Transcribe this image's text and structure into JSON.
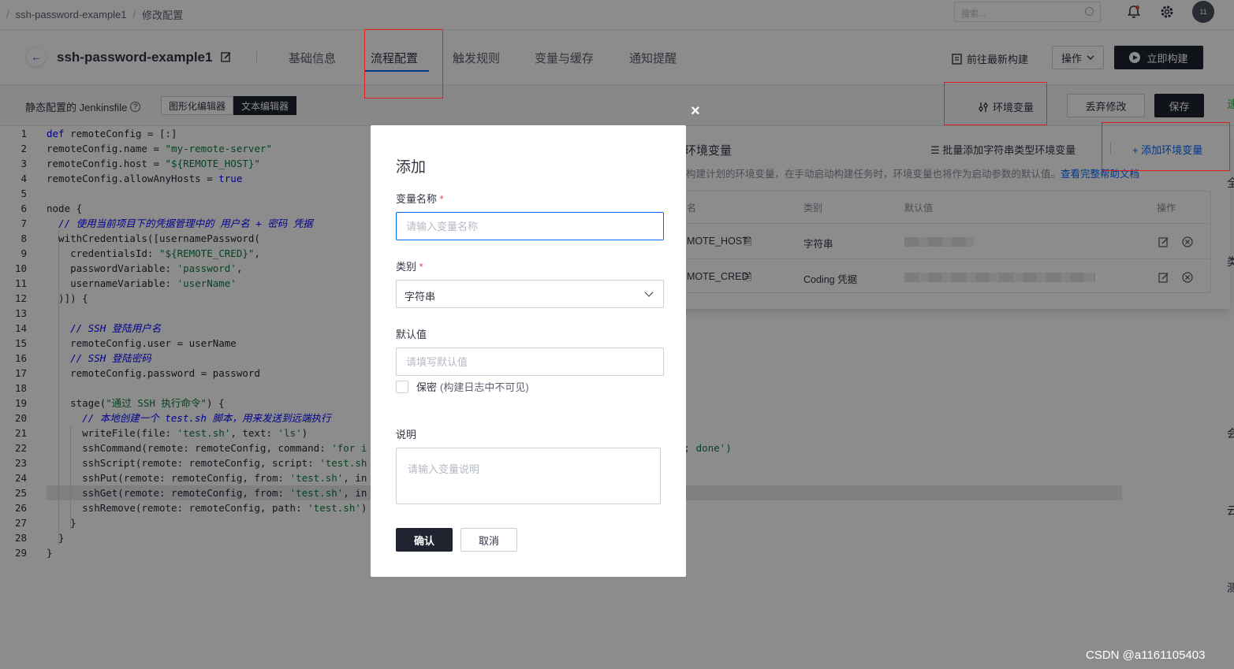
{
  "breadcrumb": {
    "project": "ssh-password-example1",
    "separator": "/",
    "page": "修改配置"
  },
  "topbar": {
    "search_placeholder": "搜索...",
    "avatar_text": "11"
  },
  "header": {
    "project_name": "ssh-password-example1",
    "tabs": [
      {
        "label": "基础信息",
        "active": false
      },
      {
        "label": "流程配置",
        "active": true
      },
      {
        "label": "触发规则",
        "active": false
      },
      {
        "label": "变量与缓存",
        "active": false
      },
      {
        "label": "通知提醒",
        "active": false
      }
    ],
    "latest_build_label": "前往最新构建",
    "operation_label": "操作",
    "build_now_label": "立即构建"
  },
  "toolbar": {
    "static_label": "静态配置的 Jenkinsfile",
    "help_glyph": "?",
    "editor_modes": [
      "图形化编辑器",
      "文本编辑器"
    ],
    "active_mode": "文本编辑器",
    "env_label": "环境变量",
    "discard_label": "丢弃修改",
    "save_label": "保存"
  },
  "code": [
    "def remoteConfig = [:]",
    "remoteConfig.name = \"my-remote-server\"",
    "remoteConfig.host = \"${REMOTE_HOST}\"",
    "remoteConfig.allowAnyHosts = true",
    "",
    "node {",
    "  // 使用当前项目下的凭据管理中的 用户名 + 密码 凭据",
    "  withCredentials([usernamePassword(",
    "    credentialsId: \"${REMOTE_CRED}\",",
    "    passwordVariable: 'password',",
    "    usernameVariable: 'userName'",
    "  )]) {",
    "",
    "    // SSH 登陆用户名",
    "    remoteConfig.user = userName",
    "    // SSH 登陆密码",
    "    remoteConfig.password = password",
    "",
    "    stage(\"通过 SSH 执行命令\") {",
    "      // 本地创建一个 test.sh 脚本，用来发送到远端执行",
    "      writeFile(file: 'test.sh', text: 'ls')",
    "      sshCommand(remote: remoteConfig, command: 'for i",
    "      sshScript(remote: remoteConfig, script: 'test.sh",
    "      sshPut(remote: remoteConfig, from: 'test.sh', in",
    "      sshGet(remote: remoteConfig, from: 'test.sh', in",
    "      sshRemove(remote: remoteConfig, path: 'test.sh')",
    "    }",
    "  }",
    "}"
  ],
  "code_overflow_line22": "1; done')",
  "env_panel": {
    "title": "环境变量",
    "batch_add_label": "批量添加字符串类型环境变量",
    "add_label": "添加环境变量",
    "description": "构建计划的环境变量，在手动启动构建任务时，环境变量也将作为启动参数的默认值。",
    "doc_link": "查看完整帮助文档",
    "columns": [
      "名",
      "类别",
      "默认值",
      "操作"
    ],
    "rows": [
      {
        "name": "MOTE_HOST",
        "type": "字符串"
      },
      {
        "name": "MOTE_CRED",
        "type": "Coding 凭据"
      }
    ]
  },
  "modal": {
    "title": "添加",
    "close_glyph": "×",
    "name_label": "变量名称",
    "required_mark": "*",
    "name_placeholder": "请输入变量名称",
    "type_label": "类别",
    "type_value": "字符串",
    "default_label": "默认值",
    "default_placeholder": "请填写默认值",
    "secret_label": "保密",
    "secret_hint": "(构建日志中不可见)",
    "desc_label": "说明",
    "desc_placeholder": "请输入变量说明",
    "confirm_label": "确认",
    "cancel_label": "取消"
  },
  "watermark": "CSDN @a1161105403",
  "edge_texts": [
    "速",
    "全",
    "类",
    "会",
    "云",
    "测"
  ],
  "colors": {
    "accent": "#0066ff",
    "dark_button": "#1f2430",
    "annotation_red": "#e02020",
    "required": "#e54545"
  }
}
